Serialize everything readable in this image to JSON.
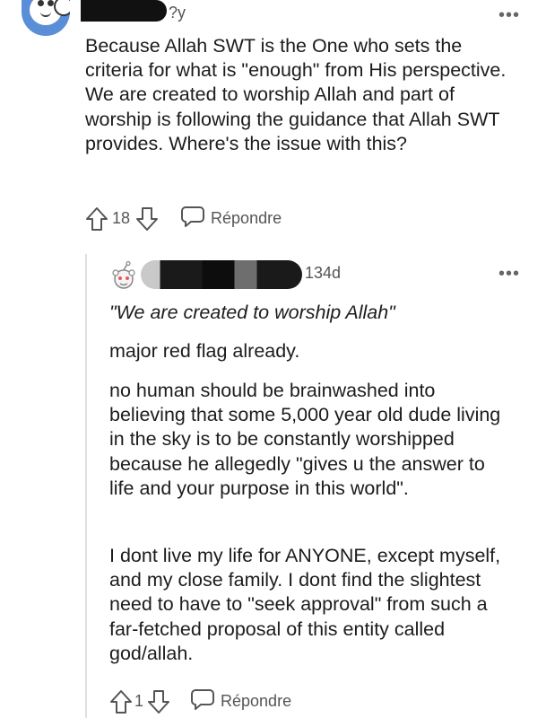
{
  "comment": {
    "age": "?y",
    "body": "Because Allah SWT is the One who sets the criteria for what is \"enough\" from His perspective. We are created to worship Allah and part of worship is following the guidance that Allah SWT provides. Where's the issue with this?",
    "votes": "18",
    "reply_label": "Répondre",
    "more": "•••"
  },
  "reply": {
    "age": "134d",
    "quote": "\"We are created to worship Allah\"",
    "paragraphs": [
      "major red flag already.",
      "no human should be brainwashed into believing that some 5,000 year old dude living in the sky is to be constantly worshipped because he allegedly \"gives u the answer to life and your purpose in this world\".",
      "I dont live my life for ANYONE, except myself, and my close family. I dont find the slightest need to have to \"seek approval\" from such a far-fetched proposal of this entity called god/allah."
    ],
    "votes": "1",
    "reply_label": "Répondre",
    "more": "•••"
  },
  "colors": {
    "text": "#1c1c1c",
    "muted": "#555555",
    "thread_line": "#e0e0e0",
    "avatar_blue": "#5a8fd8"
  },
  "icons": [
    "snoo-avatar-icon",
    "upvote-arrow-icon",
    "downvote-arrow-icon",
    "reply-bubble-icon",
    "more-options-icon",
    "default-avatar-icon"
  ]
}
